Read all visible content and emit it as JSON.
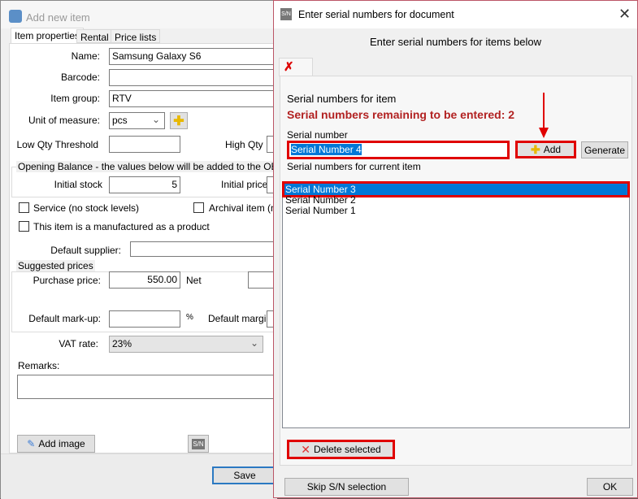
{
  "main_window": {
    "title": "Add new item",
    "tabs": [
      "Item properties",
      "Rental",
      "Price lists"
    ],
    "name_label": "Name:",
    "name_value": "Samsung Galaxy S6",
    "barcode_label": "Barcode:",
    "barcode_value": "",
    "group_label": "Item group:",
    "group_value": "RTV",
    "unit_label": "Unit of measure:",
    "unit_value": "pcs",
    "low_qty_label": "Low Qty Threshold",
    "high_qty_label": "High Qty",
    "opening_balance_label": "Opening Balance - the values below will be added to the OB docum",
    "initial_stock_label": "Initial stock",
    "initial_stock_value": "5",
    "initial_price_label": "Initial price",
    "service_label": "Service (no stock levels)",
    "archival_label": "Archival item (not",
    "manufactured_label": "This item is a manufactured as a product",
    "supplier_label": "Default supplier:",
    "suggested_prices_label": "Suggested prices",
    "purchase_price_label": "Purchase price:",
    "purchase_price_value": "550.00",
    "net_label": "Net",
    "markup_label": "Default mark-up:",
    "percent_label": "%",
    "margin_label": "Default margin:",
    "vat_label": "VAT rate:",
    "vat_value": "23%",
    "remarks_label": "Remarks:",
    "add_image_label": "Add image",
    "sn_icon_text": "S/N",
    "save_label": "Save"
  },
  "dialog": {
    "title": "Enter serial numbers for document",
    "heading": "Enter serial numbers for items below",
    "section_title": "Serial numbers for item",
    "remaining_text": "Serial numbers remaining to be entered: 2",
    "serial_label": "Serial number",
    "serial_value": "Serial Number 4",
    "add_label": "Add",
    "generate_label": "Generate",
    "list_label": "Serial numbers for current item",
    "items": [
      "Serial Number 3",
      "Serial Number 2",
      "Serial Number 1"
    ],
    "delete_label": "Delete selected",
    "skip_label": "Skip S/N selection",
    "ok_label": "OK"
  },
  "colors": {
    "highlight": "#e00000",
    "selection": "#0078d7",
    "remaining_text": "#b22222"
  }
}
